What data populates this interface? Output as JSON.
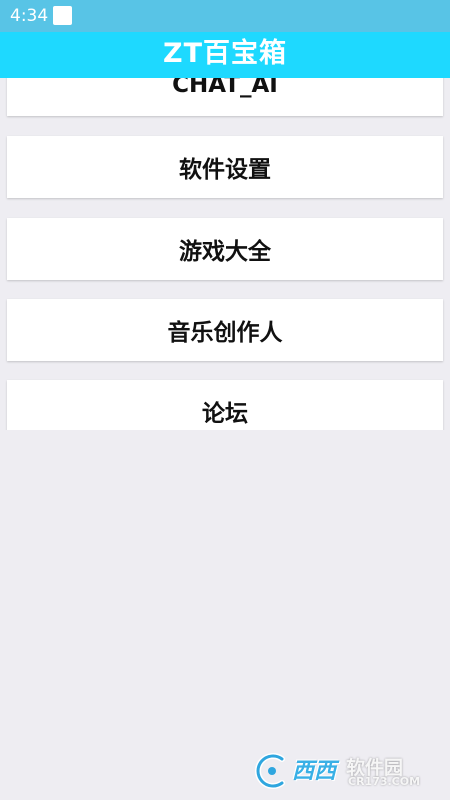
{
  "status_bar": {
    "time": "4:34"
  },
  "header": {
    "title": "ZT百宝箱",
    "background": "#1ed9ff"
  },
  "menu": {
    "items": [
      {
        "label": "CHAT_AI"
      },
      {
        "label": "软件设置"
      },
      {
        "label": "游戏大全"
      },
      {
        "label": "音乐创作人"
      },
      {
        "label": "论坛"
      }
    ]
  },
  "watermark": {
    "brand": "西西",
    "soft": "软件园",
    "url": "CR173.COM"
  }
}
